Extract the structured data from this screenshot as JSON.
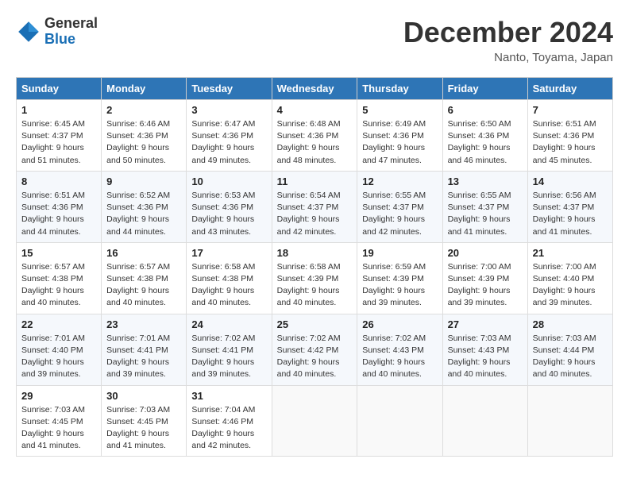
{
  "header": {
    "logo_line1": "General",
    "logo_line2": "Blue",
    "month": "December 2024",
    "location": "Nanto, Toyama, Japan"
  },
  "weekdays": [
    "Sunday",
    "Monday",
    "Tuesday",
    "Wednesday",
    "Thursday",
    "Friday",
    "Saturday"
  ],
  "weeks": [
    [
      {
        "day": "1",
        "info": "Sunrise: 6:45 AM\nSunset: 4:37 PM\nDaylight: 9 hours and 51 minutes."
      },
      {
        "day": "2",
        "info": "Sunrise: 6:46 AM\nSunset: 4:36 PM\nDaylight: 9 hours and 50 minutes."
      },
      {
        "day": "3",
        "info": "Sunrise: 6:47 AM\nSunset: 4:36 PM\nDaylight: 9 hours and 49 minutes."
      },
      {
        "day": "4",
        "info": "Sunrise: 6:48 AM\nSunset: 4:36 PM\nDaylight: 9 hours and 48 minutes."
      },
      {
        "day": "5",
        "info": "Sunrise: 6:49 AM\nSunset: 4:36 PM\nDaylight: 9 hours and 47 minutes."
      },
      {
        "day": "6",
        "info": "Sunrise: 6:50 AM\nSunset: 4:36 PM\nDaylight: 9 hours and 46 minutes."
      },
      {
        "day": "7",
        "info": "Sunrise: 6:51 AM\nSunset: 4:36 PM\nDaylight: 9 hours and 45 minutes."
      }
    ],
    [
      {
        "day": "8",
        "info": "Sunrise: 6:51 AM\nSunset: 4:36 PM\nDaylight: 9 hours and 44 minutes."
      },
      {
        "day": "9",
        "info": "Sunrise: 6:52 AM\nSunset: 4:36 PM\nDaylight: 9 hours and 44 minutes."
      },
      {
        "day": "10",
        "info": "Sunrise: 6:53 AM\nSunset: 4:36 PM\nDaylight: 9 hours and 43 minutes."
      },
      {
        "day": "11",
        "info": "Sunrise: 6:54 AM\nSunset: 4:37 PM\nDaylight: 9 hours and 42 minutes."
      },
      {
        "day": "12",
        "info": "Sunrise: 6:55 AM\nSunset: 4:37 PM\nDaylight: 9 hours and 42 minutes."
      },
      {
        "day": "13",
        "info": "Sunrise: 6:55 AM\nSunset: 4:37 PM\nDaylight: 9 hours and 41 minutes."
      },
      {
        "day": "14",
        "info": "Sunrise: 6:56 AM\nSunset: 4:37 PM\nDaylight: 9 hours and 41 minutes."
      }
    ],
    [
      {
        "day": "15",
        "info": "Sunrise: 6:57 AM\nSunset: 4:38 PM\nDaylight: 9 hours and 40 minutes."
      },
      {
        "day": "16",
        "info": "Sunrise: 6:57 AM\nSunset: 4:38 PM\nDaylight: 9 hours and 40 minutes."
      },
      {
        "day": "17",
        "info": "Sunrise: 6:58 AM\nSunset: 4:38 PM\nDaylight: 9 hours and 40 minutes."
      },
      {
        "day": "18",
        "info": "Sunrise: 6:58 AM\nSunset: 4:39 PM\nDaylight: 9 hours and 40 minutes."
      },
      {
        "day": "19",
        "info": "Sunrise: 6:59 AM\nSunset: 4:39 PM\nDaylight: 9 hours and 39 minutes."
      },
      {
        "day": "20",
        "info": "Sunrise: 7:00 AM\nSunset: 4:39 PM\nDaylight: 9 hours and 39 minutes."
      },
      {
        "day": "21",
        "info": "Sunrise: 7:00 AM\nSunset: 4:40 PM\nDaylight: 9 hours and 39 minutes."
      }
    ],
    [
      {
        "day": "22",
        "info": "Sunrise: 7:01 AM\nSunset: 4:40 PM\nDaylight: 9 hours and 39 minutes."
      },
      {
        "day": "23",
        "info": "Sunrise: 7:01 AM\nSunset: 4:41 PM\nDaylight: 9 hours and 39 minutes."
      },
      {
        "day": "24",
        "info": "Sunrise: 7:02 AM\nSunset: 4:41 PM\nDaylight: 9 hours and 39 minutes."
      },
      {
        "day": "25",
        "info": "Sunrise: 7:02 AM\nSunset: 4:42 PM\nDaylight: 9 hours and 40 minutes."
      },
      {
        "day": "26",
        "info": "Sunrise: 7:02 AM\nSunset: 4:43 PM\nDaylight: 9 hours and 40 minutes."
      },
      {
        "day": "27",
        "info": "Sunrise: 7:03 AM\nSunset: 4:43 PM\nDaylight: 9 hours and 40 minutes."
      },
      {
        "day": "28",
        "info": "Sunrise: 7:03 AM\nSunset: 4:44 PM\nDaylight: 9 hours and 40 minutes."
      }
    ],
    [
      {
        "day": "29",
        "info": "Sunrise: 7:03 AM\nSunset: 4:45 PM\nDaylight: 9 hours and 41 minutes."
      },
      {
        "day": "30",
        "info": "Sunrise: 7:03 AM\nSunset: 4:45 PM\nDaylight: 9 hours and 41 minutes."
      },
      {
        "day": "31",
        "info": "Sunrise: 7:04 AM\nSunset: 4:46 PM\nDaylight: 9 hours and 42 minutes."
      },
      null,
      null,
      null,
      null
    ]
  ]
}
